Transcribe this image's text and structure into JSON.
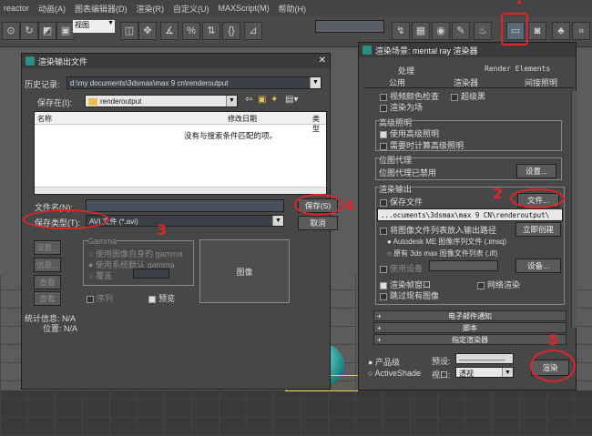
{
  "menubar": [
    "reactor",
    "动画(A)",
    "图表编辑器(D)",
    "渲染(R)",
    "自定义(U)",
    "MAXScript(M)",
    "帮助(H)"
  ],
  "toolbar": {
    "view_selector": "视图"
  },
  "file_dialog": {
    "title": "渲染输出文件",
    "history_label": "历史记录:",
    "history_value": "d:\\my documents\\3dsmax\\max 9 cn\\renderoutput",
    "save_in_label": "保存在(I):",
    "save_in_value": "renderoutput",
    "col_name": "名称",
    "col_date": "修改日期",
    "col_type": "类型",
    "empty_msg": "没有与搜索条件匹配的项。",
    "filename_label": "文件名(N):",
    "filename_value": "",
    "filetype_label": "保存类型(T):",
    "filetype_value": "AVI 文件 (*.avi)",
    "save_button": "保存(S)",
    "cancel_button": "取消",
    "setup_button": "设置...",
    "info_button": "信息...",
    "view_button": "查看",
    "gamma_label": "Gamma",
    "gamma_opt1": "使用图像自身的 gamma",
    "gamma_opt2": "使用系统默认 gamma",
    "gamma_opt3": "覆盖",
    "image_label": "图像",
    "sequence_label": "序列",
    "preview_label": "预览",
    "stats_label": "统计信息:",
    "stats_value": "N/A",
    "location_label": "位置:",
    "location_value": "N/A"
  },
  "render_dialog": {
    "title": "渲染场景: mental ray 渲染器",
    "tabs_row1": [
      "处理",
      "Render Elements"
    ],
    "tabs_row2": [
      "公用",
      "渲染器",
      "间接照明"
    ],
    "top_items": [
      "视频颜色检查",
      "超级黑",
      "渲染为场"
    ],
    "advanced_lighting": "高级照明",
    "use_adv_lighting": "使用高级照明",
    "compute_adv": "需要时计算高级照明",
    "bitmap_proxy": "位图代理",
    "bitmap_proxy_status": "位图代理已禁用",
    "setup_button": "设置...",
    "render_output": "渲染输出",
    "save_file": "保存文件",
    "files_button": "文件...",
    "output_path": "...ocuments\\3dsmax\\max 9 CN\\renderoutput\\",
    "put_file_list": "将图像文件列表放入输出路径",
    "create_now": "立即创建",
    "autodesk_option": "Autodesk ME 图像序列文件 (.imsq)",
    "legacy_option": "原有 3ds max 图像文件列表 (.ifl)",
    "use_device": "使用设备",
    "device_button": "设备...",
    "render_frame_window": "渲染帧窗口",
    "net_render": "网络渲染",
    "skip_existing": "跳过现有图像",
    "rollouts": [
      "电子邮件通知",
      "脚本",
      "指定渲染器"
    ],
    "product": "产品级",
    "activeshade": "ActiveShade",
    "preset_label": "预设:",
    "preset_value": "-------------------",
    "viewport_label": "视口:",
    "viewport_value": "透视",
    "render_button": "渲染"
  },
  "annotations": [
    "1",
    "2",
    "3",
    "4",
    "5"
  ],
  "colors": {
    "highlight_red": "#e0242a",
    "panel": "#474747",
    "titlebar": "#3b3b3b"
  }
}
